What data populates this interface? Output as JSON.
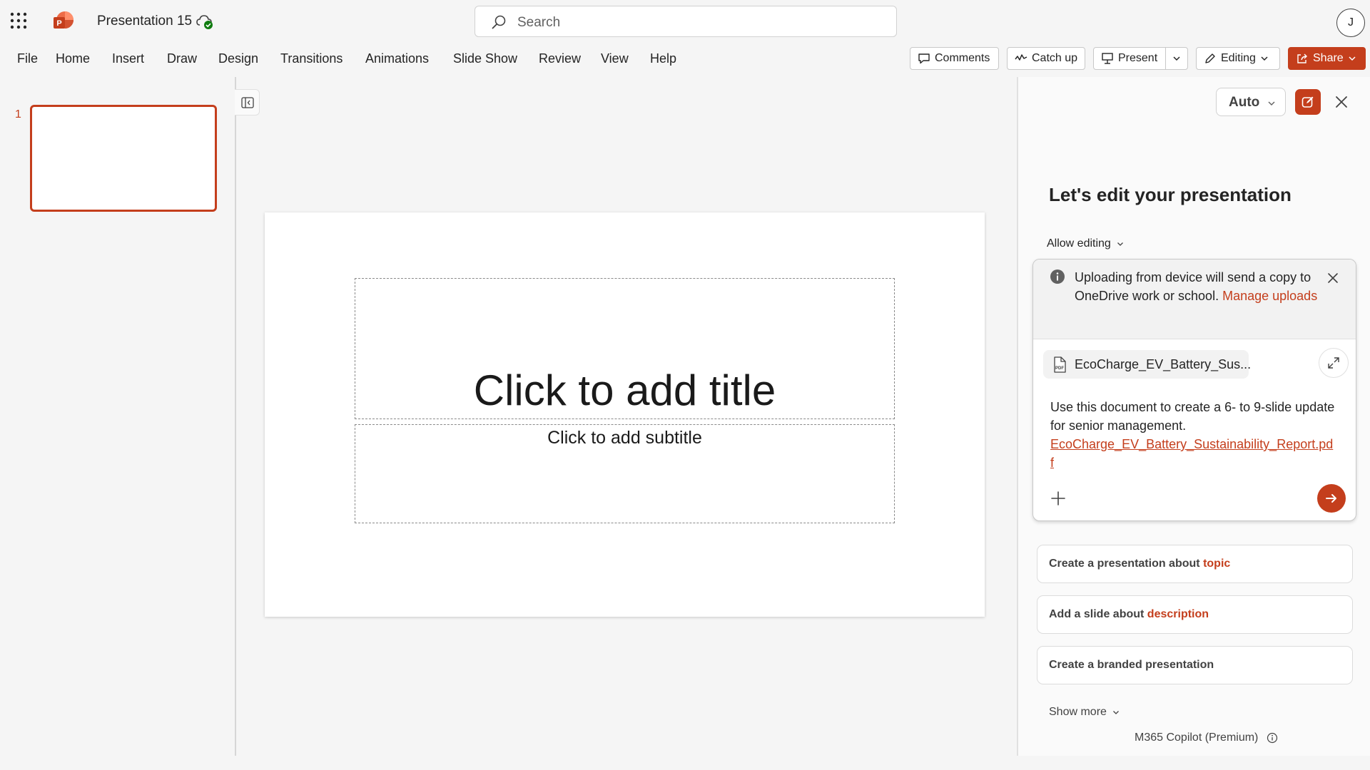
{
  "app": {
    "doc_title": "Presentation 15",
    "search_placeholder": "Search",
    "avatar_initial": "J",
    "accent_color": "#c43e1c"
  },
  "ribbon": {
    "menu": [
      "File",
      "Home",
      "Insert",
      "Draw",
      "Design",
      "Transitions",
      "Animations",
      "Slide Show",
      "Review",
      "View",
      "Help"
    ],
    "comments_label": "Comments",
    "catchup_label": "Catch up",
    "present_label": "Present",
    "editing_label": "Editing",
    "share_label": "Share"
  },
  "slides_panel": {
    "thumb_number": "1"
  },
  "slide": {
    "title_placeholder": "Click to add title",
    "subtitle_placeholder": "Click to add subtitle"
  },
  "copilot": {
    "mode_label": "Auto",
    "heading": "Let's edit your presentation",
    "allow_editing_label": "Allow editing",
    "notice_text": "Uploading from device will send a copy to OneDrive work or school.",
    "notice_link": "Manage uploads",
    "file_chip": "EcoCharge_EV_Battery_Sus...",
    "prompt_text": "Use this document to create a 6- to 9-slide update for senior management.",
    "prompt_link": "EcoCharge_EV_Battery_Sustainability_Report.pdf",
    "suggestions": [
      {
        "prefix": "Create a presentation about",
        "highlight": "topic"
      },
      {
        "prefix": "Add a slide about",
        "highlight": "description"
      },
      {
        "prefix": "Create a branded presentation",
        "highlight": ""
      }
    ],
    "show_more_label": "Show more",
    "footer_label": "M365 Copilot (Premium)"
  },
  "icons": [
    "waffle-icon",
    "powerpoint-logo-icon",
    "cloud-saved-icon",
    "search-icon",
    "comment-icon",
    "catchup-icon",
    "present-icon",
    "chevron-down-icon",
    "pencil-icon",
    "share-icon",
    "panel-toggle-icon",
    "new-chat-icon",
    "close-icon",
    "info-icon",
    "pdf-file-icon",
    "expand-icon",
    "plus-icon",
    "send-arrow-icon"
  ]
}
